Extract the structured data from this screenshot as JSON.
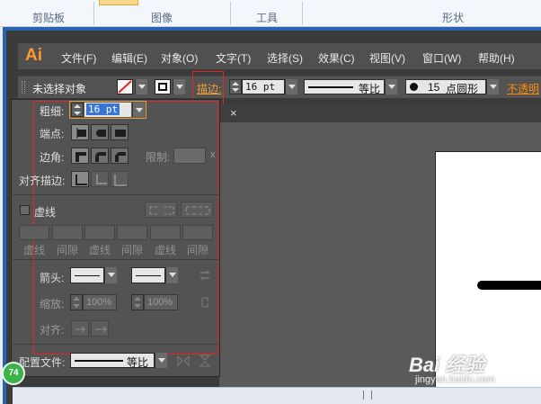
{
  "ribbon": {
    "groups": [
      "剪贴板",
      "图像",
      "工具",
      "形状"
    ]
  },
  "app": {
    "logo": "Ai"
  },
  "menu": {
    "items": [
      "文件(F)",
      "编辑(E)",
      "对象(O)",
      "文字(T)",
      "选择(S)",
      "效果(C)",
      "视图(V)",
      "窗口(W)",
      "帮助(H)"
    ]
  },
  "control": {
    "selection": "未选择对象",
    "stroke_link": "描边:",
    "stroke_weight": "16 pt",
    "profile": "等比",
    "brush_size": "15",
    "brush_name": "点圆形",
    "opacity_label": "不透明"
  },
  "tab": {
    "close": "×"
  },
  "panel": {
    "weight_label": "粗细:",
    "weight_value": "16 pt",
    "cap_label": "端点:",
    "corner_label": "边角:",
    "limit_label": "限制:",
    "limit_x": "x",
    "align_label": "对齐描边:",
    "dashed_label": "虚线",
    "dash_labels": [
      "虚线",
      "间隙",
      "虚线",
      "间隙",
      "虚线",
      "间隙"
    ],
    "arrow_label": "箭头:",
    "scale_label": "缩放:",
    "scale_start": "100%",
    "scale_end": "100%",
    "arrow_align_label": "对齐:",
    "profile_label": "配置文件:",
    "profile_value": "等比"
  },
  "badge": "74",
  "watermark": {
    "brand": "Bai 经验",
    "url": "jingyan.baidu.com"
  },
  "colors": {
    "accent_red": "#e02626",
    "ai_orange": "#ff9a2e",
    "stroke_link": "#f0a030",
    "opacity_link": "#ff8a00"
  }
}
